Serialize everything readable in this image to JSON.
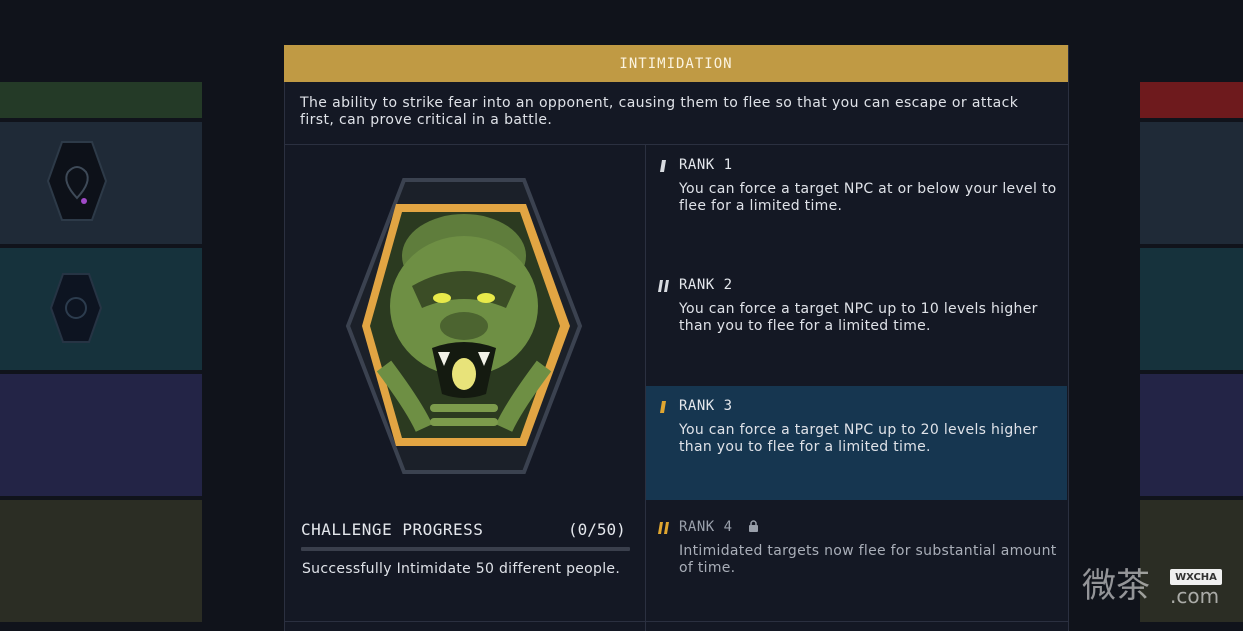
{
  "skill": {
    "title": "INTIMIDATION",
    "description": "The ability to strike fear into an opponent, causing them to flee so that you can escape or attack first, can prove critical in a battle."
  },
  "ranks": [
    {
      "label": "RANK 1",
      "text": "You can force a target NPC at or below your level to flee for a limited time.",
      "state": "unlocked"
    },
    {
      "label": "RANK 2",
      "text": "You can force a target NPC up to 10 levels higher than you to flee for a limited time.",
      "state": "unlocked"
    },
    {
      "label": "RANK 3",
      "text": "You can force a target NPC up to 20 levels higher than you to flee for a limited time.",
      "state": "selected"
    },
    {
      "label": "RANK 4",
      "text": "Intimidated targets now flee for substantial amount of time.",
      "state": "locked"
    }
  ],
  "challenge": {
    "title": "CHALLENGE PROGRESS",
    "count": "(0/50)",
    "progress": 0.0,
    "description": "Successfully Intimidate 50 different people."
  },
  "watermark": {
    "text": "WXCHA",
    "domain": ".com"
  },
  "colors": {
    "gold": "#c09a44",
    "selected": "#163650",
    "rank_icon": "#e0a630"
  }
}
